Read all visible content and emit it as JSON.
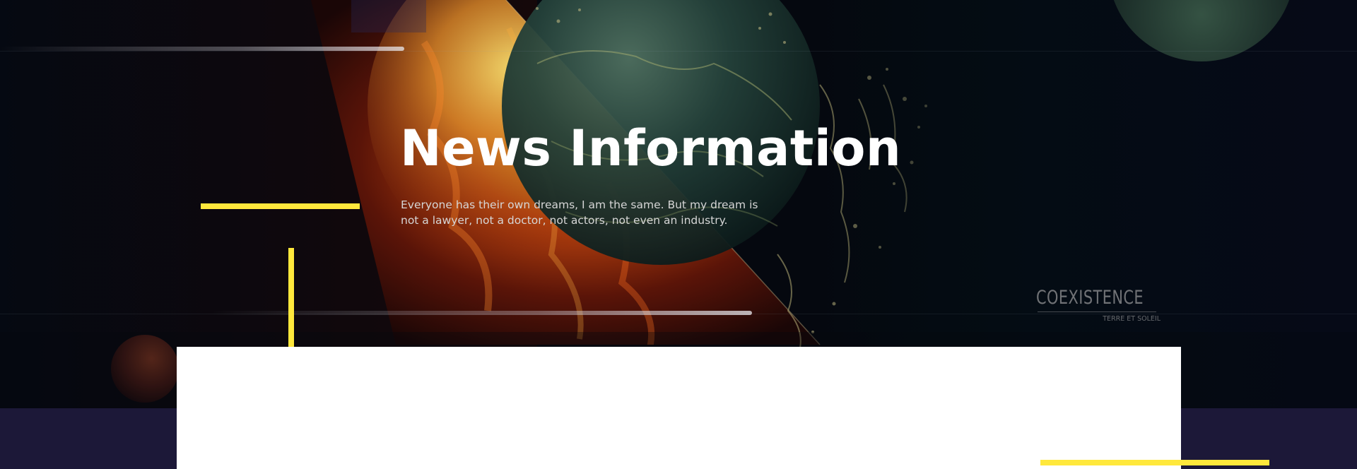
{
  "hero": {
    "title": "News Information",
    "description": "Everyone has their own dreams, I am the same. But my dream is not a lawyer, not a doctor, not actors, not even an industry."
  },
  "artwork": {
    "brand_name": "COEXISTENCE",
    "brand_subtitle": "TERRE ET SOLEIL"
  },
  "colors": {
    "accent": "#ffe83c",
    "page_background": "#1c1838",
    "hero_background": "#060a12",
    "card_background": "#ffffff",
    "title_text": "#ffffff",
    "description_text": "#d6d6d6"
  }
}
